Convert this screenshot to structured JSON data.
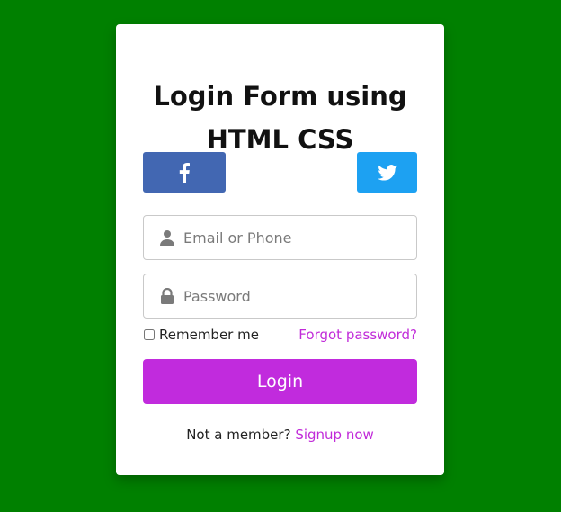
{
  "colors": {
    "background": "#008000",
    "card": "#ffffff",
    "facebook": "#4267b2",
    "twitter": "#1da1f2",
    "accent": "#c12bdd"
  },
  "form": {
    "title_line1": "Login Form using",
    "title_line2": "HTML CSS",
    "social": {
      "facebook_icon": "facebook-icon",
      "twitter_icon": "twitter-icon"
    },
    "email": {
      "icon": "user-icon",
      "placeholder": "Email or Phone",
      "value": ""
    },
    "password": {
      "icon": "lock-icon",
      "placeholder": "Password",
      "value": ""
    },
    "remember_label": "Remember me",
    "remember_checked": false,
    "forgot_label": "Forgot password?",
    "login_label": "Login",
    "signup_prompt": "Not a member?",
    "signup_link": "Signup now"
  }
}
